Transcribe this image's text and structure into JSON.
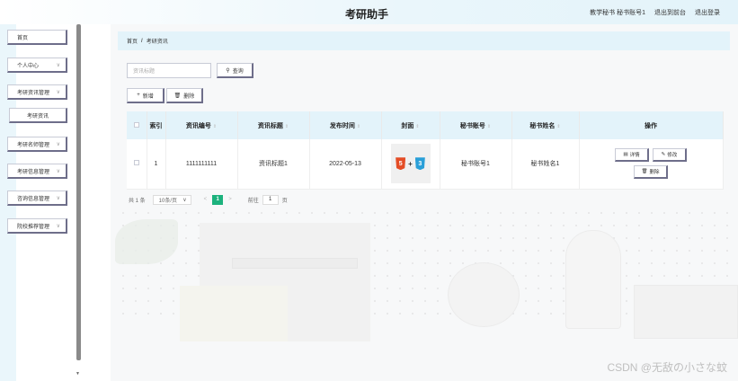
{
  "header": {
    "app_title": "考研助手",
    "user_info": "教学秘书 秘书账号1",
    "back_front": "退出到前台",
    "logout": "退出登录"
  },
  "sidebar": {
    "items": [
      {
        "label": "首页"
      },
      {
        "label": "个人中心"
      },
      {
        "label": "考研资讯管理"
      },
      {
        "label": "考研资讯"
      },
      {
        "label": "考研名师管理"
      },
      {
        "label": "考研信息管理"
      },
      {
        "label": "咨询信息管理"
      },
      {
        "label": "院校推荐管理"
      }
    ]
  },
  "breadcrumb": {
    "home": "首页",
    "sep": "/",
    "current": "考研资讯"
  },
  "search": {
    "placeholder": "资讯标题",
    "button": "查询"
  },
  "toolbar": {
    "add": "新增",
    "delete": "删除"
  },
  "table": {
    "headers": [
      "索引",
      "资讯编号",
      "资讯标题",
      "发布时间",
      "封面",
      "秘书账号",
      "秘书姓名",
      "操作"
    ],
    "rows": [
      {
        "index": "1",
        "code": "1111111111",
        "title": "资讯标题1",
        "date": "2022-05-13",
        "cover_icons": [
          "5",
          "3"
        ],
        "account": "秘书账号1",
        "name": "秘书姓名1",
        "actions": [
          "详情",
          "修改",
          "删除"
        ]
      }
    ]
  },
  "pagination": {
    "total": "共 1 条",
    "page_size": "10条/页",
    "current_page": "1",
    "goto_label": "前往",
    "goto_value": "1",
    "page_unit": "页"
  },
  "watermark": "CSDN @无敌の小さな蚊",
  "colors": {
    "accent": "#1cb27d",
    "header_bg": "#e3f3fa",
    "button_shadow": "#6e6e8a"
  }
}
